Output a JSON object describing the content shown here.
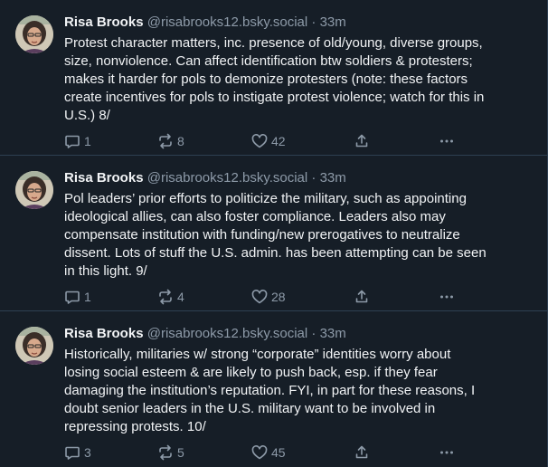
{
  "posts": [
    {
      "author_name": "Risa Brooks",
      "author_handle": "@risabrooks12.bsky.social",
      "separator": "·",
      "time": "33m",
      "lines": [
        "Protest character matters, inc. presence of old/young, diverse groups,",
        "size, nonviolence. Can affect identification btw soldiers & protesters;",
        "makes it harder for pols to demonize protesters (note: these factors",
        "create incentives for pols to instigate protest violence; watch for this in",
        "U.S.)  8/"
      ],
      "replies": "1",
      "reposts": "8",
      "likes": "42"
    },
    {
      "author_name": "Risa Brooks",
      "author_handle": "@risabrooks12.bsky.social",
      "separator": "·",
      "time": "33m",
      "lines": [
        "Pol leaders’ prior efforts to politicize the military, such as appointing",
        "ideological allies, can also foster compliance. Leaders also may",
        "compensate institution with funding/new prerogatives to neutralize",
        "dissent. Lots of stuff the U.S. admin. has been attempting can be seen",
        "in this light. 9/"
      ],
      "replies": "1",
      "reposts": "4",
      "likes": "28"
    },
    {
      "author_name": "Risa Brooks",
      "author_handle": "@risabrooks12.bsky.social",
      "separator": "·",
      "time": "33m",
      "lines": [
        "Historically, militaries w/ strong “corporate” identities worry about",
        "losing social esteem & are likely to push back, esp. if they fear",
        "damaging the institution’s reputation. FYI, in part for these reasons, I",
        "doubt senior leaders in the U.S. military want to be involved in",
        "repressing protests.  10/"
      ],
      "replies": "3",
      "reposts": "5",
      "likes": "45"
    }
  ],
  "icons": {
    "reply": "reply-icon",
    "repost": "repost-icon",
    "like": "heart-icon",
    "share": "share-icon",
    "more": "more-options-icon"
  },
  "colors": {
    "background": "#161e27",
    "text": "#f1f3f5",
    "muted": "#8d9aa8",
    "divider": "#2e4052"
  }
}
